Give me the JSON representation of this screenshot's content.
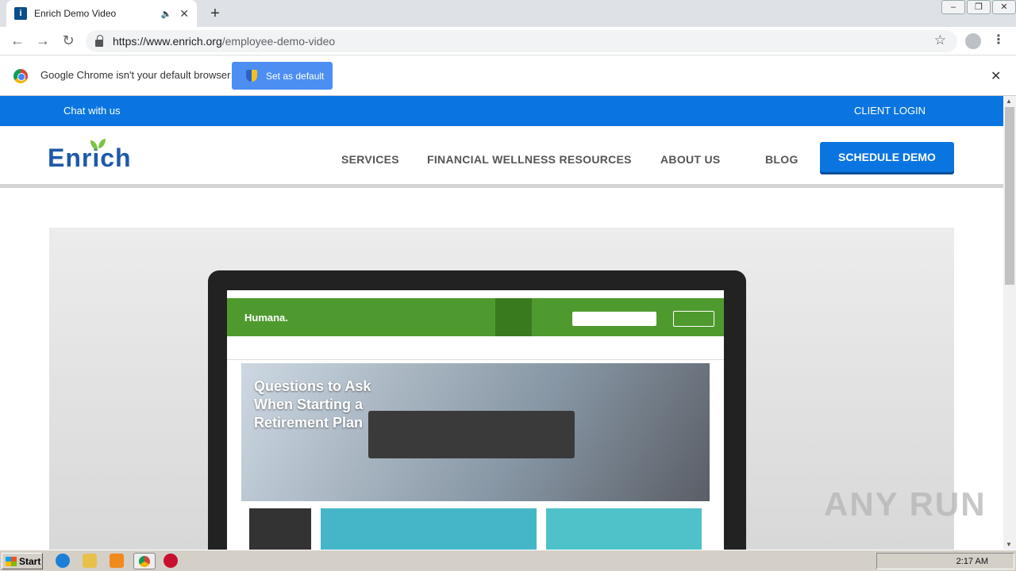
{
  "browser": {
    "tab_title": "Enrich Demo Video",
    "url_domain": "https://www.enrich.org",
    "url_path": "/employee-demo-video"
  },
  "infobar": {
    "message": "Google Chrome isn't your default browser",
    "button_label": "Set as default"
  },
  "site": {
    "topbar": {
      "chat": "Chat with us",
      "login": "CLIENT LOGIN"
    },
    "logo": "Enrich",
    "nav": [
      "SERVICES",
      "FINANCIAL WELLNESS RESOURCES",
      "ABOUT US",
      "BLOG"
    ],
    "cta": "SCHEDULE DEMO"
  },
  "video": {
    "screen_logo": "Humana.",
    "hero_text": "Questions to Ask When Starting a Retirement Plan"
  },
  "watermark": "ANY RUN",
  "taskbar": {
    "start": "Start",
    "clock": "2:17 AM"
  },
  "colors": {
    "brand_blue": "#0a75e0",
    "logo_blue": "#1e5aa8",
    "leaf_green": "#7cc243"
  }
}
